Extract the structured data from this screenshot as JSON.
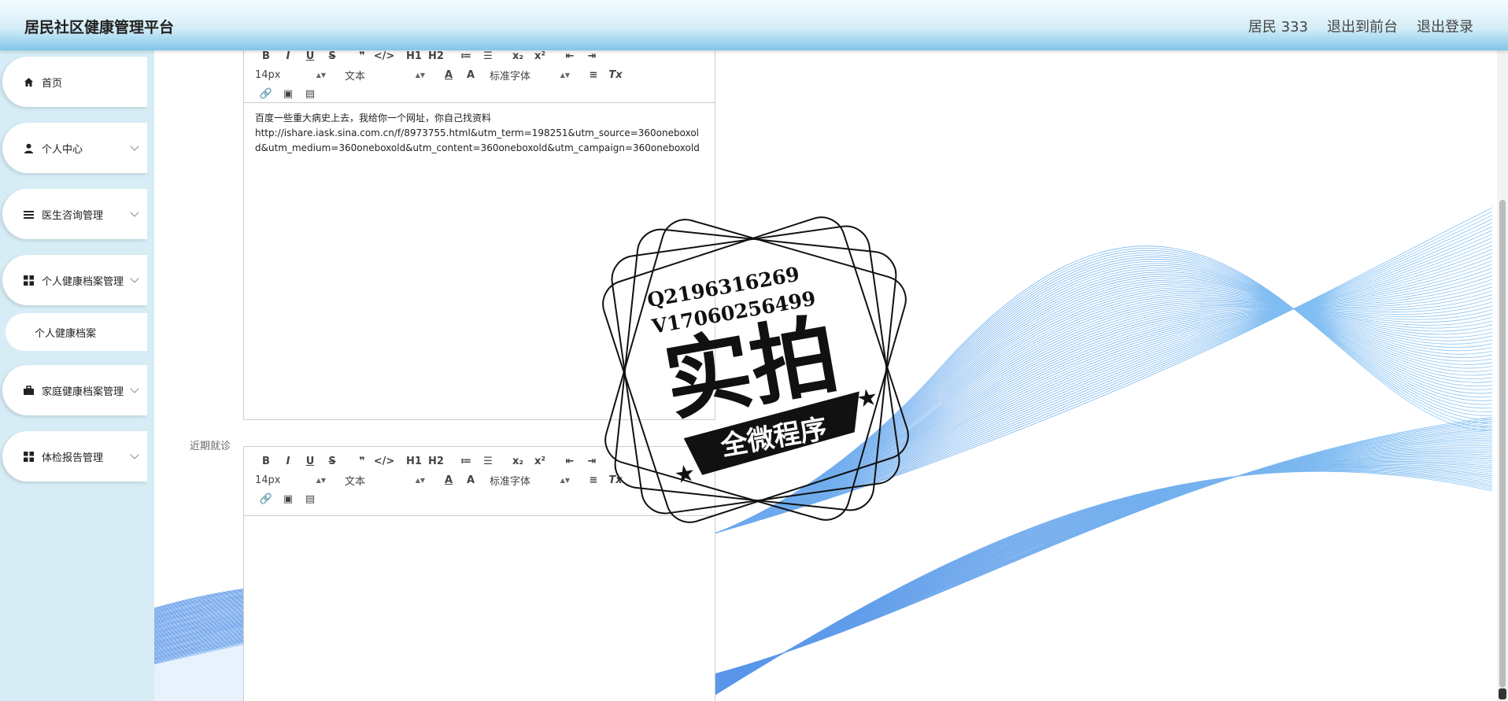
{
  "header": {
    "brand": "居民社区健康管理平台",
    "user": "居民 333",
    "back_front": "退出到前台",
    "logout": "退出登录"
  },
  "sidebar": {
    "items": [
      {
        "label": "首页",
        "icon": "home-icon"
      },
      {
        "label": "个人中心",
        "icon": "user-icon"
      },
      {
        "label": "医生咨询管理",
        "icon": "list-icon"
      },
      {
        "label": "个人健康档案管理",
        "icon": "grid-icon"
      },
      {
        "label": "个人健康档案",
        "icon": ""
      },
      {
        "label": "家庭健康档案管理",
        "icon": "briefcase-icon"
      },
      {
        "label": "体检报告管理",
        "icon": "grid-icon"
      }
    ]
  },
  "editor1": {
    "font_size": "14px",
    "header_type": "文本",
    "font_family": "标准字体",
    "content_line1": "百度一些重大病史上去，我给你一个网址，你自己找资料",
    "content_line2": "http://ishare.iask.sina.com.cn/f/8973755.html&utm_term=198251&utm_source=360oneboxold&utm_medium=360oneboxold&utm_content=360oneboxold&utm_campaign=360oneboxold"
  },
  "editor2": {
    "label": "近期就诊",
    "font_size": "14px",
    "header_type": "文本",
    "font_family": "标准字体"
  },
  "toolbar": {
    "bold": "B",
    "italic": "I",
    "underline": "U",
    "strike": "S",
    "quote": "❞",
    "code": "</>",
    "h1": "H1",
    "h2": "H2",
    "ordered": "≔",
    "bullet": "☰",
    "sub": "x₂",
    "sup": "x²",
    "indent_dec": "⇤",
    "indent_inc": "⇥",
    "color": "A",
    "bg": "A",
    "align": "≡",
    "clean": "Tx"
  },
  "watermark": {
    "qq": "Q2196316269",
    "vx": "V17060256499",
    "big": "实拍",
    "banner": "全微程序"
  }
}
